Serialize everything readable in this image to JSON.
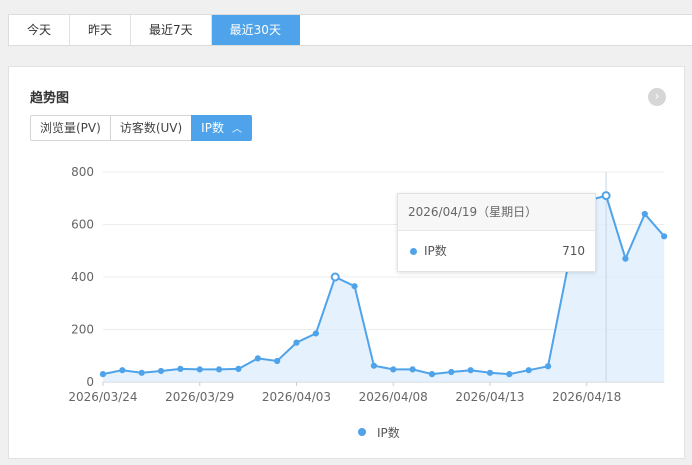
{
  "range_tabs": [
    {
      "label": "今天",
      "active": false
    },
    {
      "label": "昨天",
      "active": false
    },
    {
      "label": "最近7天",
      "active": false
    },
    {
      "label": "最近30天",
      "active": true
    }
  ],
  "card": {
    "title": "趋势图",
    "more_icon": "chevron-right-circle-icon",
    "metric_tabs": [
      {
        "label": "浏览量(PV)",
        "active": false
      },
      {
        "label": "访客数(UV)",
        "active": false
      },
      {
        "label": "IP数",
        "active": true
      }
    ]
  },
  "tooltip": {
    "date": "2026/04/19（星期日）",
    "series": "IP数",
    "value": "710"
  },
  "colors": {
    "accent": "#4ea3ea",
    "area": "#deedfb"
  },
  "chart_data": {
    "type": "area",
    "series": [
      {
        "name": "IP数",
        "values": [
          30,
          45,
          35,
          42,
          50,
          48,
          48,
          50,
          90,
          80,
          150,
          185,
          400,
          365,
          62,
          48,
          48,
          30,
          38,
          45,
          35,
          30,
          45,
          60,
          430,
          690,
          710,
          470,
          640,
          555
        ]
      }
    ],
    "x_tick_labels": [
      "2026/03/24",
      "2026/03/29",
      "2026/04/03",
      "2026/04/08",
      "2026/04/13",
      "2026/04/18"
    ],
    "y_tick_labels": [
      "0",
      "200",
      "400",
      "600",
      "800"
    ],
    "ylim": [
      0,
      800
    ],
    "highlight_index": 26,
    "legend": "IP数",
    "legend_position": "bottom-center"
  }
}
